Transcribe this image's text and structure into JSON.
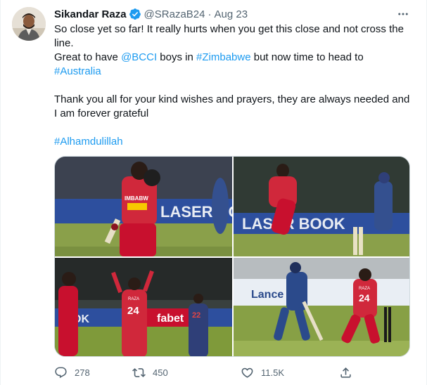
{
  "author": {
    "name": "Sikandar Raza",
    "handle": "@SRazaB24",
    "separator": "·",
    "date": "Aug 23"
  },
  "text": {
    "line1": "So close yet so far! It really hurts when you get this close and not cross the",
    "line2": "line.",
    "line3_a": "Great to have ",
    "line3_link1": "@BCCI",
    "line3_b": " boys in ",
    "line3_link2": "#Zimbabwe",
    "line3_c": " but now time to head to",
    "line4_link": "#Australia",
    "line5": "Thank you all for your kind wishes and prayers, they are always needed and",
    "line6": "I am forever grateful",
    "hashtag": "#Alhamdulillah"
  },
  "photos": {
    "p1_banner": "LASER BOOK",
    "p1_jersey": "IMBABW",
    "p2_banner": "LASER BOOK",
    "p3_jersey_num": "24",
    "p3_jersey_name": "RAZA",
    "p3_ad": "fabet",
    "p3_ad2": "OK",
    "p3_num22": "22",
    "p4_ad": "Lance",
    "p4_jersey_num": "24",
    "p4_jersey_name": "RAZA"
  },
  "actions": {
    "replies": "278",
    "retweets": "450",
    "likes": "11.5K"
  },
  "colors": {
    "link": "#1d9bf0",
    "secondary_text": "#536471",
    "zimbabwe_red": "#c8102e",
    "zimbabwe_yellow": "#f7c900",
    "india_blue": "#2b4a8b",
    "field_green": "#7f9a3a"
  },
  "icons": {
    "verified": "verified-badge-icon",
    "more": "more-options-icon",
    "reply": "reply-icon",
    "retweet": "retweet-icon",
    "like": "heart-icon",
    "share": "share-icon"
  }
}
